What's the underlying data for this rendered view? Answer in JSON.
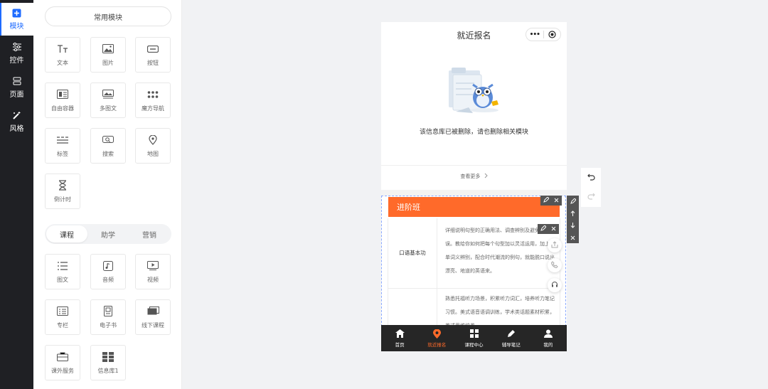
{
  "nav": {
    "items": [
      {
        "label": "模块",
        "icon": "plus-square-icon",
        "active": true
      },
      {
        "label": "控件",
        "icon": "sliders-icon",
        "active": false
      },
      {
        "label": "页面",
        "icon": "pages-icon",
        "active": false
      },
      {
        "label": "风格",
        "icon": "magic-wand-icon",
        "active": false
      }
    ]
  },
  "panel": {
    "common_title": "常用模块",
    "common_tiles": [
      {
        "label": "文本",
        "icon": "text-icon"
      },
      {
        "label": "图片",
        "icon": "image-icon"
      },
      {
        "label": "按钮",
        "icon": "button-icon"
      },
      {
        "label": "自由容器",
        "icon": "container-icon"
      },
      {
        "label": "多图文",
        "icon": "multi-image-text-icon"
      },
      {
        "label": "魔方导航",
        "icon": "grid-dots-icon"
      },
      {
        "label": "标签",
        "icon": "label-lines-icon"
      },
      {
        "label": "搜索",
        "icon": "search-icon"
      },
      {
        "label": "地图",
        "icon": "map-pin-icon"
      },
      {
        "label": "倒计时",
        "icon": "hourglass-icon"
      }
    ],
    "segments": [
      {
        "label": "课程",
        "active": true
      },
      {
        "label": "助学",
        "active": false
      },
      {
        "label": "营销",
        "active": false
      }
    ],
    "course_tiles": [
      {
        "label": "图文",
        "icon": "article-icon"
      },
      {
        "label": "音频",
        "icon": "audio-icon"
      },
      {
        "label": "视频",
        "icon": "video-icon"
      },
      {
        "label": "专栏",
        "icon": "column-icon"
      },
      {
        "label": "电子书",
        "icon": "ebook-icon"
      },
      {
        "label": "线下课程",
        "icon": "offline-course-icon"
      },
      {
        "label": "课外服务",
        "icon": "service-icon"
      },
      {
        "label": "信息库1",
        "icon": "database-icon"
      }
    ]
  },
  "phone": {
    "title": "就近报名",
    "capsule_more": "•••",
    "empty_text": "该信息库已被删除，请也删除相关模块",
    "more_link": "查看更多",
    "banner": "进阶班",
    "table": [
      {
        "key": "口语基本功",
        "value": "详细说明句型的正确用法、调查辨别及避免的错误。教给你如何把每个句型加以灵活运用，加上简单词义辨别，配合时代潮流的例句，就能脱口说出漂亮、地道的英语来。"
      },
      {
        "key": "",
        "value": "熟悉托福听力场景，积累听力词汇，培养听力笔记习惯。美式语音语调训练，学术类话题素材积累，美式思维培养。"
      }
    ],
    "tabs": [
      {
        "label": "首页",
        "icon": "home-icon",
        "active": false
      },
      {
        "label": "就近报名",
        "icon": "location-icon",
        "active": true
      },
      {
        "label": "课程中心",
        "icon": "grid-icon",
        "active": false
      },
      {
        "label": "辅导笔记",
        "icon": "note-icon",
        "active": false
      },
      {
        "label": "我的",
        "icon": "user-icon",
        "active": false
      }
    ]
  },
  "colors": {
    "nav_bg": "#1f2024",
    "active_blue": "#1e6bff",
    "accent_orange": "#ff6a2a",
    "tabbar_bg": "#262626"
  }
}
